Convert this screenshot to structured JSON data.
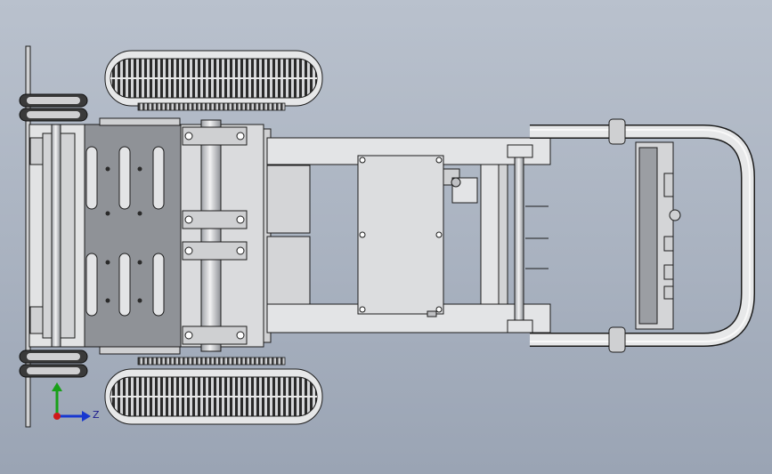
{
  "viewport": {
    "background_top": "#b9c1cd",
    "background_bottom": "#9aa4b4"
  },
  "colors": {
    "part_fill": "#d9dadc",
    "part_fill_dark": "#8f9297",
    "plate_fill": "#9b9ea3",
    "edge": "#1c1c1c",
    "tire": "#2a2a2a",
    "tire_highlight": "#e8e8e8",
    "axis_x_red": "#d01818",
    "axis_y_green": "#18a018",
    "axis_z_blue": "#1838d0"
  },
  "triad": {
    "axis_label": "Z",
    "icon": "coordinate-triad-icon"
  }
}
